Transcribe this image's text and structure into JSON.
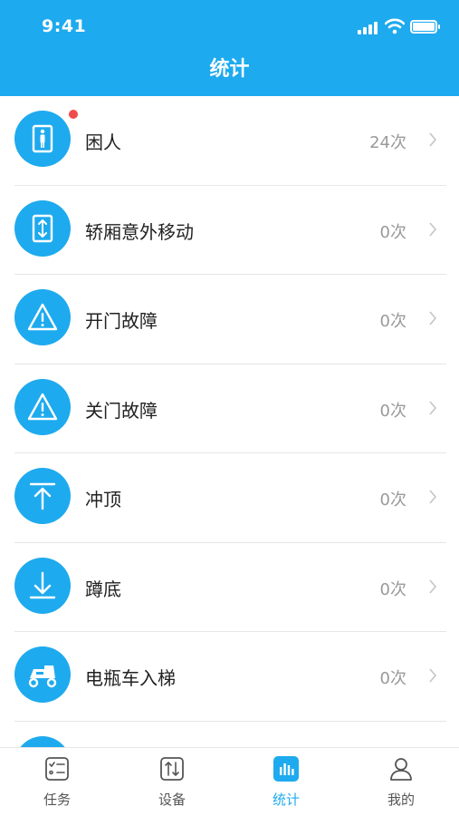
{
  "status_bar": {
    "time": "9:41"
  },
  "header": {
    "title": "统计"
  },
  "accent_color": "#1eaaee",
  "list_items": [
    {
      "label": "困人",
      "count": "24次",
      "icon": "elevator-person-icon",
      "has_badge": true
    },
    {
      "label": "轿厢意外移动",
      "count": "0次",
      "icon": "updown-arrows-icon"
    },
    {
      "label": "开门故障",
      "count": "0次",
      "icon": "warning-icon"
    },
    {
      "label": "关门故障",
      "count": "0次",
      "icon": "warning-icon"
    },
    {
      "label": "冲顶",
      "count": "0次",
      "icon": "arrow-up-to-top-icon"
    },
    {
      "label": "蹲底",
      "count": "0次",
      "icon": "arrow-down-to-bottom-icon"
    },
    {
      "label": "电瓶车入梯",
      "count": "0次",
      "icon": "scooter-icon"
    }
  ],
  "tabbar": {
    "tabs": [
      {
        "label": "任务",
        "icon": "task-list-icon"
      },
      {
        "label": "设备",
        "icon": "device-icon"
      },
      {
        "label": "统计",
        "icon": "stats-icon",
        "active": true
      },
      {
        "label": "我的",
        "icon": "profile-icon"
      }
    ]
  }
}
